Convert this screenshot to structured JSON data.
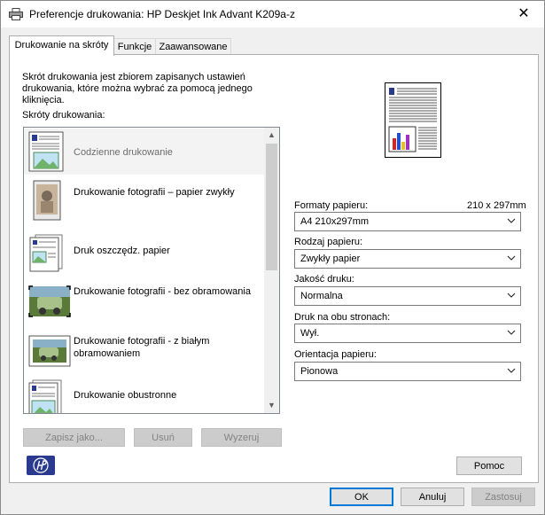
{
  "window": {
    "title": "Preferencje drukowania: HP Deskjet Ink Advant K209a-z",
    "close_glyph": "✕"
  },
  "tabs": [
    {
      "label": "Drukowanie na skróty"
    },
    {
      "label": "Funkcje"
    },
    {
      "label": "Zaawansowane"
    }
  ],
  "panel": {
    "description": "Skrót drukowania jest zbiorem zapisanych ustawień drukowania, które można wybrać za pomocą jednego kliknięcia.",
    "shortcuts_label": "Skróty drukowania:",
    "shortcuts": [
      {
        "label": "Codzienne drukowanie",
        "icon": "document-icon",
        "selected": true
      },
      {
        "label": "Drukowanie fotografii – papier zwykły",
        "icon": "photo-plain-paper-icon"
      },
      {
        "label": "Druk oszczędz. papier",
        "icon": "paper-saving-icon"
      },
      {
        "label": "Drukowanie fotografii - bez obramowania",
        "icon": "borderless-photo-icon"
      },
      {
        "label": "Drukowanie fotografii - z białym obramowaniem",
        "icon": "white-border-photo-icon"
      },
      {
        "label": "Drukowanie obustronne",
        "icon": "duplex-icon"
      }
    ],
    "buttons": {
      "save_as": "Zapisz jako...",
      "delete": "Usuń",
      "reset": "Wyzeruj",
      "help": "Pomoc"
    },
    "paper_size_value": "210 x 297mm",
    "fields": {
      "paper_format": {
        "label": "Formaty papieru:",
        "value": "A4 210x297mm"
      },
      "paper_type": {
        "label": "Rodzaj papieru:",
        "value": "Zwykły papier"
      },
      "print_quality": {
        "label": "Jakość druku:",
        "value": "Normalna"
      },
      "duplex": {
        "label": "Druk na obu stronach:",
        "value": "Wył."
      },
      "orientation": {
        "label": "Orientacja papieru:",
        "value": "Pionowa"
      }
    }
  },
  "footer": {
    "ok": "OK",
    "cancel": "Anuluj",
    "apply": "Zastosuj"
  },
  "colors": {
    "accent": "#0078d7",
    "hp_blue": "#2a3a8f"
  }
}
